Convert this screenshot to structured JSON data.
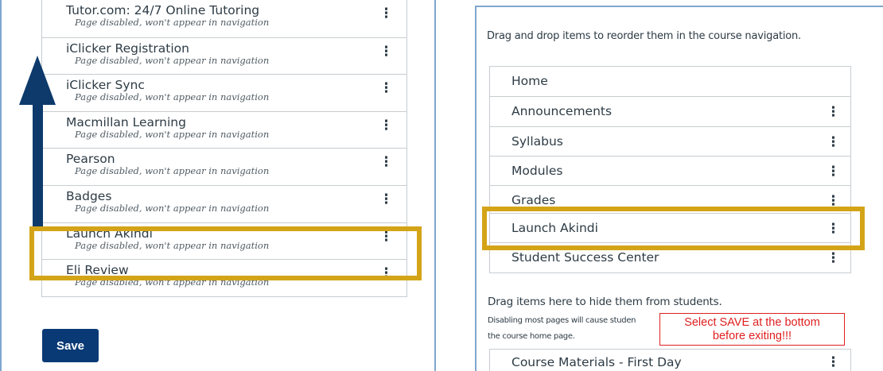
{
  "left": {
    "disabled_items": [
      {
        "title": "Tutor.com: 24/7 Online Tutoring",
        "subtitle": "Page disabled, won't appear in navigation"
      },
      {
        "title": "iClicker Registration",
        "subtitle": "Page disabled, won't appear in navigation"
      },
      {
        "title": "iClicker Sync",
        "subtitle": "Page disabled, won't appear in navigation"
      },
      {
        "title": "Macmillan Learning",
        "subtitle": "Page disabled, won't appear in navigation"
      },
      {
        "title": "Pearson",
        "subtitle": "Page disabled, won't appear in navigation"
      },
      {
        "title": "Badges",
        "subtitle": "Page disabled, won't appear in navigation"
      },
      {
        "title": "Launch Akindi",
        "subtitle": "Page disabled, won't appear in navigation"
      },
      {
        "title": "Eli Review",
        "subtitle": "Page disabled, won't appear in navigation"
      }
    ],
    "save_label": "Save"
  },
  "right": {
    "reorder_instruction": "Drag and drop items to reorder them in the course navigation.",
    "nav_items": [
      {
        "title": "Home"
      },
      {
        "title": "Announcements"
      },
      {
        "title": "Syllabus"
      },
      {
        "title": "Modules"
      },
      {
        "title": "Grades"
      },
      {
        "title": "Launch Akindi"
      },
      {
        "title": "Student Success Center"
      }
    ],
    "hide_instruction": "Drag items here to hide them from students.",
    "disabling_note_line1": "Disabling most pages will cause studen",
    "disabling_note_line2": "the course home page.",
    "hidden_items": [
      {
        "title": "Course Materials - First Day"
      }
    ]
  },
  "callout": {
    "line1": "Select SAVE at the bottom",
    "line2": "before exiting!!!"
  },
  "kebab_glyph": "⋮",
  "colors": {
    "highlight": "#d4a418",
    "arrow": "#0d3a6b",
    "save_button": "#0a3a75",
    "callout_red": "#e02020",
    "panel_border": "#7fa6cf"
  }
}
